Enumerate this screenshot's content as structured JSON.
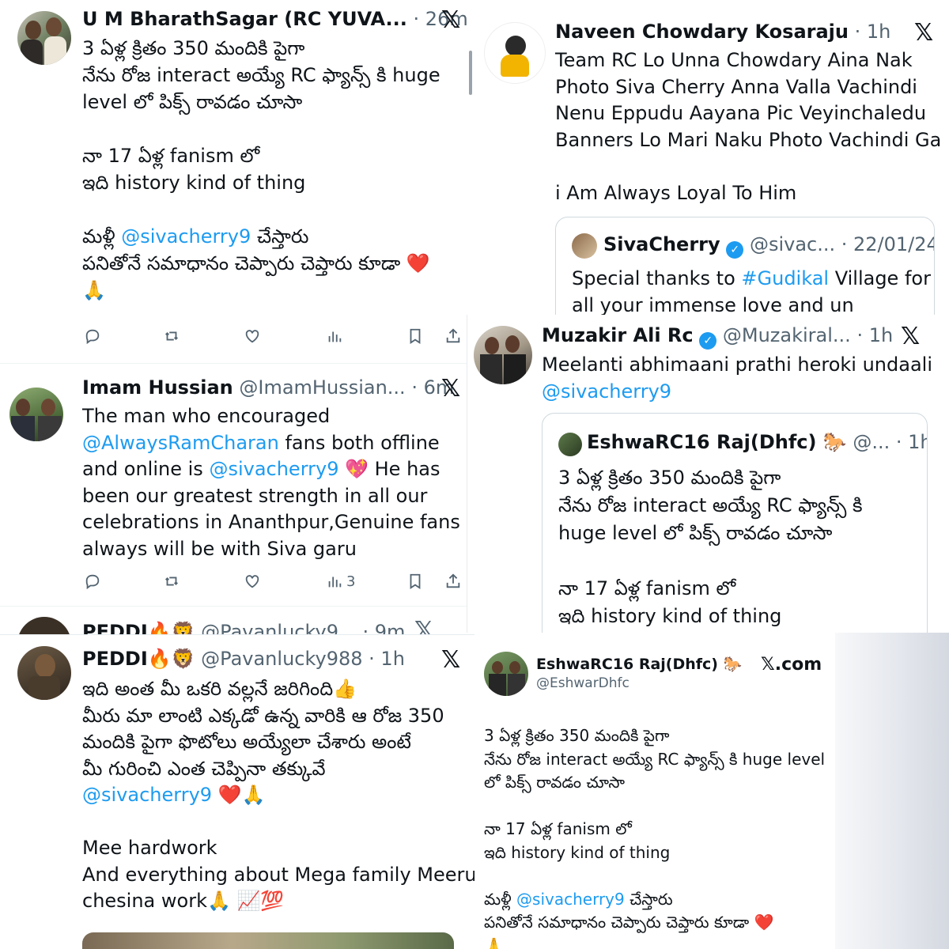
{
  "tweet1": {
    "name": "U M BharathSagar (RC YUVA...",
    "time": "· 26m",
    "lines": [
      "3 ఏళ్ల క్రితం 350 మందికి పైగా",
      "నేను రోజ interact అయ్యే RC ఫ్యాన్స్ కి huge",
      "level లో పిక్స్ రావడం చూసా",
      "",
      "నా 17 ఏళ్ల fanism లో",
      "ఇది history kind of thing",
      "",
      "మళ్లీ",
      "@sivacherry9",
      "చేస్తారు",
      "పనితోనే సమాధానం చెప్పారు చెప్తారు కూడా",
      "❤️",
      "🙏"
    ]
  },
  "tweet2": {
    "name": "Imam Hussian",
    "handle": "@ImamHussian...",
    "time": "· 6m",
    "lines": [
      "The man who encouraged",
      "@AlwaysRamCharan",
      "fans both offline",
      "and online is",
      "@sivacherry9",
      "💖 He has",
      "been our greatest strength in all our",
      "celebrations in Ananthpur,Genuine fans",
      "always will be with Siva garu"
    ],
    "views": "3"
  },
  "tweet3_peek": {
    "name": "PEDDI🔥🦁",
    "handle": "@Pavanlucky9...",
    "time": "· 9m"
  },
  "tweet4": {
    "name": "Naveen Chowdary Kosaraju",
    "time": "· 1h",
    "lines": [
      "Team RC Lo Unna Chowdary Aina Nak",
      "Photo Siva Cherry Anna Valla Vachindi",
      "Nenu Eppudu Aayana Pic Veyinchaledu",
      "Banners Lo Mari Naku Photo Vachindi Ga",
      "",
      "i Am Always Loyal To Him"
    ],
    "quote": {
      "name": "SivaCherry",
      "handle": "@sivac...",
      "date": "· 22/01/24",
      "line1_pre": "Special thanks to",
      "line1_link": "#Gudikal",
      "line1_post": "Village for",
      "line2": "all your immense love and un"
    }
  },
  "tweet5": {
    "name": "Muzakir Ali Rc",
    "handle": "@Muzakiral...",
    "time": "· 1h",
    "line1": "Meelanti abhimaani prathi heroki undaali",
    "mention": "@sivacherry9",
    "quote": {
      "name": "EshwaRC16 Raj(Dhfc) 🐎",
      "handle": "@...",
      "time": "· 1h",
      "lines": [
        "3 ఏళ్ల క్రితం 350 మందికి పైగా",
        "నేను రోజ interact అయ్యే RC ఫ్యాన్స్ కి",
        "huge level లో పిక్స్ రావడం చూసా",
        "",
        "నా 17 ఏళ్ల fanism లో",
        "ఇది history kind of thing"
      ]
    }
  },
  "tweet6": {
    "name": "PEDDI🔥🦁",
    "handle": "@Pavanlucky988",
    "time": "· 1h",
    "lines": [
      "ఇది అంత మీ ఒకరి వల్లనే జరిగింది👍",
      "మీరు మా లాంటి ఎక్కడో ఉన్న వారికి ఆ రోజ 350",
      "మందికి పైగా ఫొటోలు అయ్యేలా చేశారు అంటే",
      "మీ గురించి ఎంత చెప్పినా తక్కువే",
      "@sivacherry9",
      "❤️🙏",
      "",
      "Mee hardwork",
      "And everything about Mega family Meeru",
      "chesina work🙏 📈💯"
    ]
  },
  "tweet7": {
    "name": "EshwaRC16 Raj(Dhfc) 🐎",
    "handle": "@EshwarDhfc",
    "brand": "𝕏.com",
    "lines": [
      "3 ఏళ్ల క్రితం 350 మందికి పైగా",
      "నేను రోజ interact అయ్యే RC ఫ్యాన్స్ కి huge level",
      "లో పిక్స్ రావడం చూసా",
      "",
      "నా 17 ఏళ్ల fanism లో",
      "ఇది history kind of thing",
      "",
      "మళ్లీ",
      "@sivacherry9",
      "చేస్తారు",
      "పనితోనే సమాధానం చెప్పారు చెప్తారు కూడా",
      "❤️",
      "🙏"
    ]
  },
  "icons": {
    "x_logo": "𝕏"
  },
  "colors": {
    "link": "#1d9bf0",
    "muted": "#536471",
    "text": "#0f1419"
  }
}
